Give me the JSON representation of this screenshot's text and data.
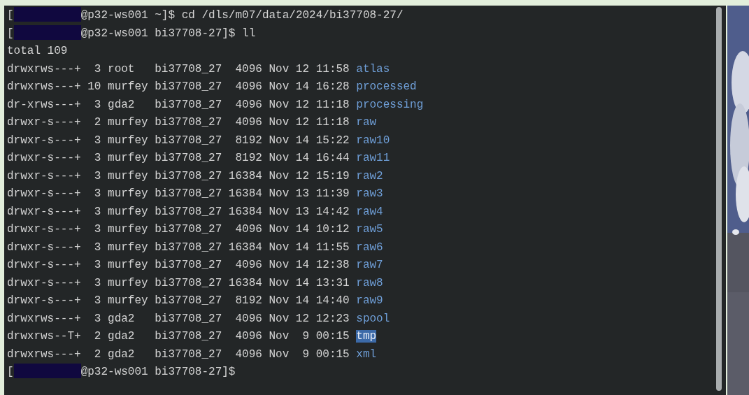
{
  "terminal": {
    "lines": [
      {
        "kind": "prompt",
        "bracket": "[",
        "redacted": true,
        "prompt": "@p32-ws001 ~]$",
        "command": "cd /dls/m07/data/2024/bi37708-27/"
      },
      {
        "kind": "prompt",
        "bracket": "[",
        "redacted": true,
        "prompt": "@p32-ws001 bi37708-27]$",
        "command": "ll"
      },
      {
        "kind": "plain",
        "text": "total 109"
      },
      {
        "kind": "entry",
        "info": "drwxrws---+  3 root   bi37708_27  4096 Nov 12 11:58",
        "name": "atlas",
        "highlighted": false
      },
      {
        "kind": "entry",
        "info": "drwxrws---+ 10 murfey bi37708_27  4096 Nov 14 16:28",
        "name": "processed",
        "highlighted": false
      },
      {
        "kind": "entry",
        "info": "dr-xrws---+  3 gda2   bi37708_27  4096 Nov 12 11:18",
        "name": "processing",
        "highlighted": false
      },
      {
        "kind": "entry",
        "info": "drwxr-s---+  2 murfey bi37708_27  4096 Nov 12 11:18",
        "name": "raw",
        "highlighted": false
      },
      {
        "kind": "entry",
        "info": "drwxr-s---+  3 murfey bi37708_27  8192 Nov 14 15:22",
        "name": "raw10",
        "highlighted": false
      },
      {
        "kind": "entry",
        "info": "drwxr-s---+  3 murfey bi37708_27  8192 Nov 14 16:44",
        "name": "raw11",
        "highlighted": false
      },
      {
        "kind": "entry",
        "info": "drwxr-s---+  3 murfey bi37708_27 16384 Nov 12 15:19",
        "name": "raw2",
        "highlighted": false
      },
      {
        "kind": "entry",
        "info": "drwxr-s---+  3 murfey bi37708_27 16384 Nov 13 11:39",
        "name": "raw3",
        "highlighted": false
      },
      {
        "kind": "entry",
        "info": "drwxr-s---+  3 murfey bi37708_27 16384 Nov 13 14:42",
        "name": "raw4",
        "highlighted": false
      },
      {
        "kind": "entry",
        "info": "drwxr-s---+  3 murfey bi37708_27  4096 Nov 14 10:12",
        "name": "raw5",
        "highlighted": false
      },
      {
        "kind": "entry",
        "info": "drwxr-s---+  3 murfey bi37708_27 16384 Nov 14 11:55",
        "name": "raw6",
        "highlighted": false
      },
      {
        "kind": "entry",
        "info": "drwxr-s---+  3 murfey bi37708_27  4096 Nov 14 12:38",
        "name": "raw7",
        "highlighted": false
      },
      {
        "kind": "entry",
        "info": "drwxr-s---+  3 murfey bi37708_27 16384 Nov 14 13:31",
        "name": "raw8",
        "highlighted": false
      },
      {
        "kind": "entry",
        "info": "drwxr-s---+  3 murfey bi37708_27  8192 Nov 14 14:40",
        "name": "raw9",
        "highlighted": false
      },
      {
        "kind": "entry",
        "info": "drwxrws---+  3 gda2   bi37708_27  4096 Nov 12 12:23",
        "name": "spool",
        "highlighted": false
      },
      {
        "kind": "entry",
        "info": "drwxrws--T+  2 gda2   bi37708_27  4096 Nov  9 00:15",
        "name": "tmp",
        "highlighted": true
      },
      {
        "kind": "entry",
        "info": "drwxrws---+  2 gda2   bi37708_27  4096 Nov  9 00:15",
        "name": "xml",
        "highlighted": false
      },
      {
        "kind": "prompt",
        "bracket": "[",
        "redacted": true,
        "prompt": "@p32-ws001 bi37708-27]$"
      }
    ]
  }
}
